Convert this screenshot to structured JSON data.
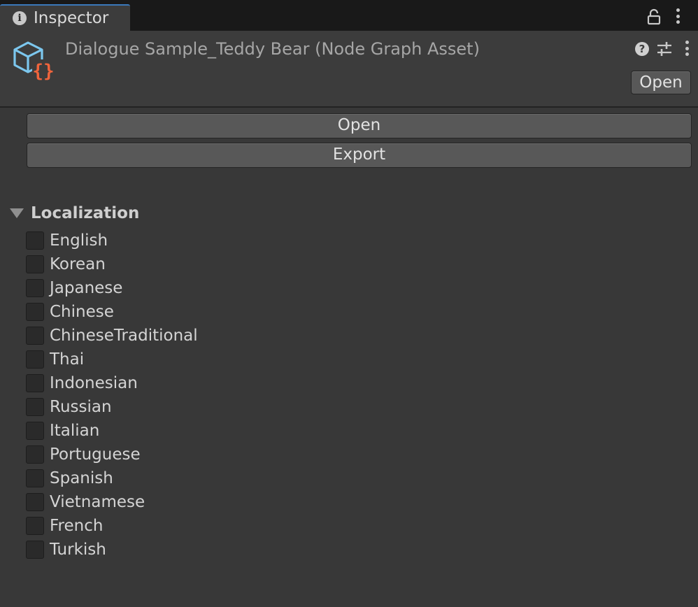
{
  "tab": {
    "label": "Inspector",
    "info_icon": "info-icon",
    "lock_icon": "lock-icon",
    "menu_icon": "kebab-menu-icon"
  },
  "header": {
    "title": "Dialogue Sample_Teddy Bear (Node Graph Asset)",
    "asset_icon": "node-graph-asset-icon",
    "help_icon_glyph": "?",
    "open_label": "Open"
  },
  "actions": {
    "open_label": "Open",
    "export_label": "Export"
  },
  "localization": {
    "label": "Localization",
    "expanded": true,
    "languages": [
      {
        "label": "English",
        "checked": false
      },
      {
        "label": "Korean",
        "checked": false
      },
      {
        "label": "Japanese",
        "checked": false
      },
      {
        "label": "Chinese",
        "checked": false
      },
      {
        "label": "ChineseTraditional",
        "checked": false
      },
      {
        "label": "Thai",
        "checked": false
      },
      {
        "label": "Indonesian",
        "checked": false
      },
      {
        "label": "Russian",
        "checked": false
      },
      {
        "label": "Italian",
        "checked": false
      },
      {
        "label": "Portuguese",
        "checked": false
      },
      {
        "label": "Spanish",
        "checked": false
      },
      {
        "label": "Vietnamese",
        "checked": false
      },
      {
        "label": "French",
        "checked": false
      },
      {
        "label": "Turkish",
        "checked": false
      }
    ]
  },
  "colors": {
    "background": "#383838",
    "tab_accent": "#3a79bb",
    "asset_icon_cube": "#7cc7ee",
    "asset_icon_braces": "#f0643c"
  }
}
